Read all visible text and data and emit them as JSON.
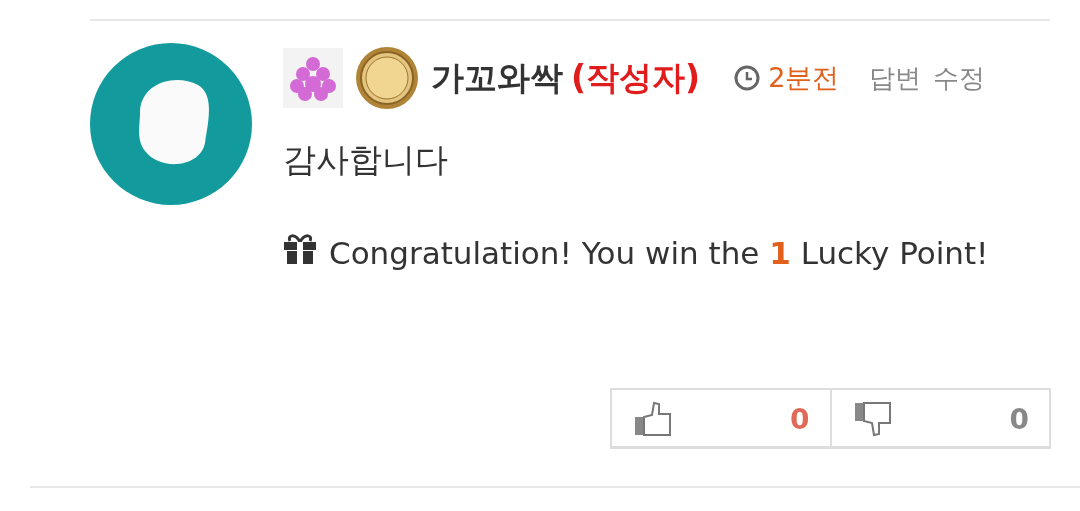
{
  "comment": {
    "author": "가꼬와싹",
    "author_tag": "(작성자)",
    "time": "2분전",
    "actions": [
      "답변",
      "수정"
    ],
    "body": "감사합니다",
    "notice": "Congratulation! You win the **1** Lucky Point!",
    "votes": [
      {
        "kind": "up",
        "count": "0"
      },
      {
        "kind": "down",
        "count": "0"
      }
    ]
  }
}
